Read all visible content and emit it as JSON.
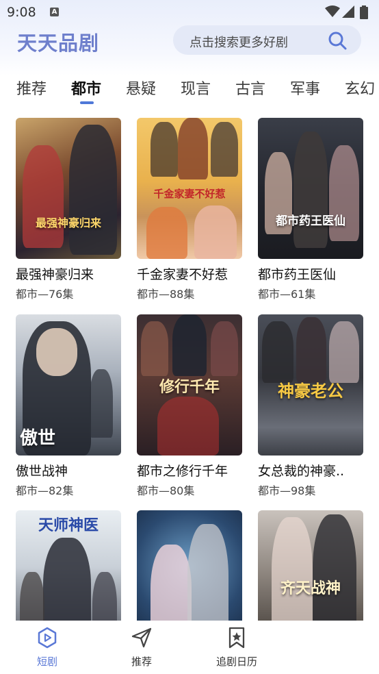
{
  "status": {
    "time": "9:08",
    "notification_icon": "a-icon"
  },
  "header": {
    "app_title": "天天品剧",
    "search_placeholder": "点击搜索更多好剧"
  },
  "tabs": [
    {
      "label": "推荐"
    },
    {
      "label": "都市"
    },
    {
      "label": "悬疑"
    },
    {
      "label": "现言"
    },
    {
      "label": "古言"
    },
    {
      "label": "军事"
    },
    {
      "label": "玄幻"
    }
  ],
  "active_tab": "都市",
  "dramas": [
    {
      "title": "最强神豪归来",
      "meta": "都市—76集",
      "poster_text": "最强神豪归来"
    },
    {
      "title": "千金家妻不好惹",
      "meta": "都市—88集",
      "poster_text": "千金家妻不好惹"
    },
    {
      "title": "都市药王医仙",
      "meta": "都市—61集",
      "poster_text": "都市药王医仙"
    },
    {
      "title": "傲世战神",
      "meta": "都市—82集",
      "poster_text": "傲世"
    },
    {
      "title": "都市之修行千年",
      "meta": "都市—80集",
      "poster_text": "修行千年"
    },
    {
      "title": "女总裁的神豪..",
      "meta": "都市—98集",
      "poster_text": "神豪老公"
    },
    {
      "title": "",
      "meta": "",
      "poster_text": "天师神医"
    },
    {
      "title": "",
      "meta": "",
      "poster_text": ""
    },
    {
      "title": "",
      "meta": "",
      "poster_text": "齐天战神"
    }
  ],
  "bottom_nav": [
    {
      "label": "短剧",
      "icon": "play-icon",
      "active": true
    },
    {
      "label": "推荐",
      "icon": "send-icon",
      "active": false
    },
    {
      "label": "追剧日历",
      "icon": "bookmark-star-icon",
      "active": false
    }
  ],
  "colors": {
    "accent": "#5a78d6",
    "title": "#6e7fcc",
    "search_bg": "#e4e9f7"
  }
}
